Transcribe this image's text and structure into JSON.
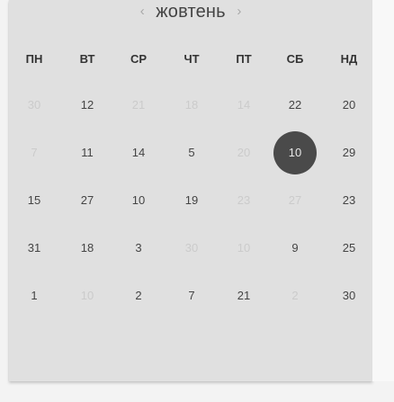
{
  "header": {
    "prev_arrow": "‹",
    "month": "жовтень",
    "next_arrow": "›"
  },
  "weekdays": [
    "ПН",
    "ВТ",
    "СР",
    "ЧТ",
    "ПТ",
    "СБ",
    "НД"
  ],
  "weeks": [
    [
      {
        "label": "30",
        "muted": true
      },
      {
        "label": "12",
        "muted": false
      },
      {
        "label": "21",
        "muted": true
      },
      {
        "label": "18",
        "muted": true
      },
      {
        "label": "14",
        "muted": true
      },
      {
        "label": "22",
        "muted": false
      },
      {
        "label": "20",
        "muted": false
      }
    ],
    [
      {
        "label": "7",
        "muted": true
      },
      {
        "label": "11",
        "muted": false
      },
      {
        "label": "14",
        "muted": false
      },
      {
        "label": "5",
        "muted": false
      },
      {
        "label": "20",
        "muted": true
      },
      {
        "label": "10",
        "muted": false,
        "selected": true
      },
      {
        "label": "29",
        "muted": false
      }
    ],
    [
      {
        "label": "15",
        "muted": false
      },
      {
        "label": "27",
        "muted": false
      },
      {
        "label": "10",
        "muted": false
      },
      {
        "label": "19",
        "muted": false
      },
      {
        "label": "23",
        "muted": true
      },
      {
        "label": "27",
        "muted": true
      },
      {
        "label": "23",
        "muted": false
      }
    ],
    [
      {
        "label": "31",
        "muted": false
      },
      {
        "label": "18",
        "muted": false
      },
      {
        "label": "3",
        "muted": false
      },
      {
        "label": "30",
        "muted": true
      },
      {
        "label": "10",
        "muted": true
      },
      {
        "label": "9",
        "muted": false
      },
      {
        "label": "25",
        "muted": false
      }
    ],
    [
      {
        "label": "1",
        "muted": false
      },
      {
        "label": "10",
        "muted": true
      },
      {
        "label": "2",
        "muted": false
      },
      {
        "label": "7",
        "muted": false
      },
      {
        "label": "21",
        "muted": false
      },
      {
        "label": "2",
        "muted": true
      },
      {
        "label": "30",
        "muted": false
      }
    ]
  ],
  "colors": {
    "card_background": "#e0e0e0",
    "selected_background": "#4a4a4a",
    "muted_text": "#cbcbcb",
    "text": "#444444"
  }
}
